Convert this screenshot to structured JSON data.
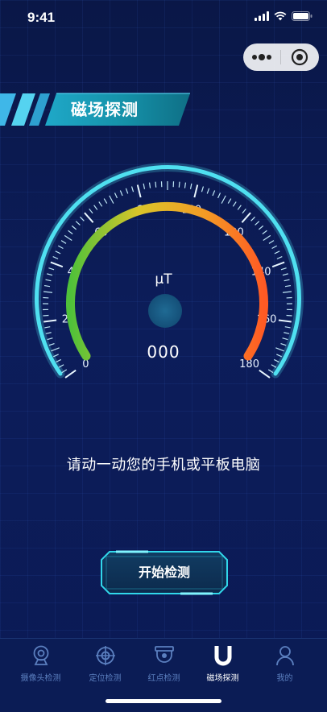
{
  "status_bar": {
    "time": "9:41"
  },
  "header": {
    "title": "磁场探测"
  },
  "gauge": {
    "unit": "μT",
    "reading": "000",
    "min": 0,
    "max": 180,
    "tick_labels": [
      "0",
      "20",
      "40",
      "60",
      "80",
      "100",
      "120",
      "140",
      "160",
      "180"
    ],
    "colors": [
      "#4fc13a",
      "#d9c52a",
      "#f39a25",
      "#ff5a24"
    ]
  },
  "hint": "请动一动您的手机或平板电脑",
  "action": {
    "start_label": "开始检测"
  },
  "tabbar": {
    "items": [
      {
        "label": "摄像头检测",
        "icon": "camera-icon",
        "active": false
      },
      {
        "label": "定位检测",
        "icon": "crosshair-icon",
        "active": false
      },
      {
        "label": "红点检测",
        "icon": "security-camera-icon",
        "active": false
      },
      {
        "label": "磁场探测",
        "icon": "magnet-icon",
        "active": true
      },
      {
        "label": "我的",
        "icon": "user-icon",
        "active": false
      }
    ]
  }
}
